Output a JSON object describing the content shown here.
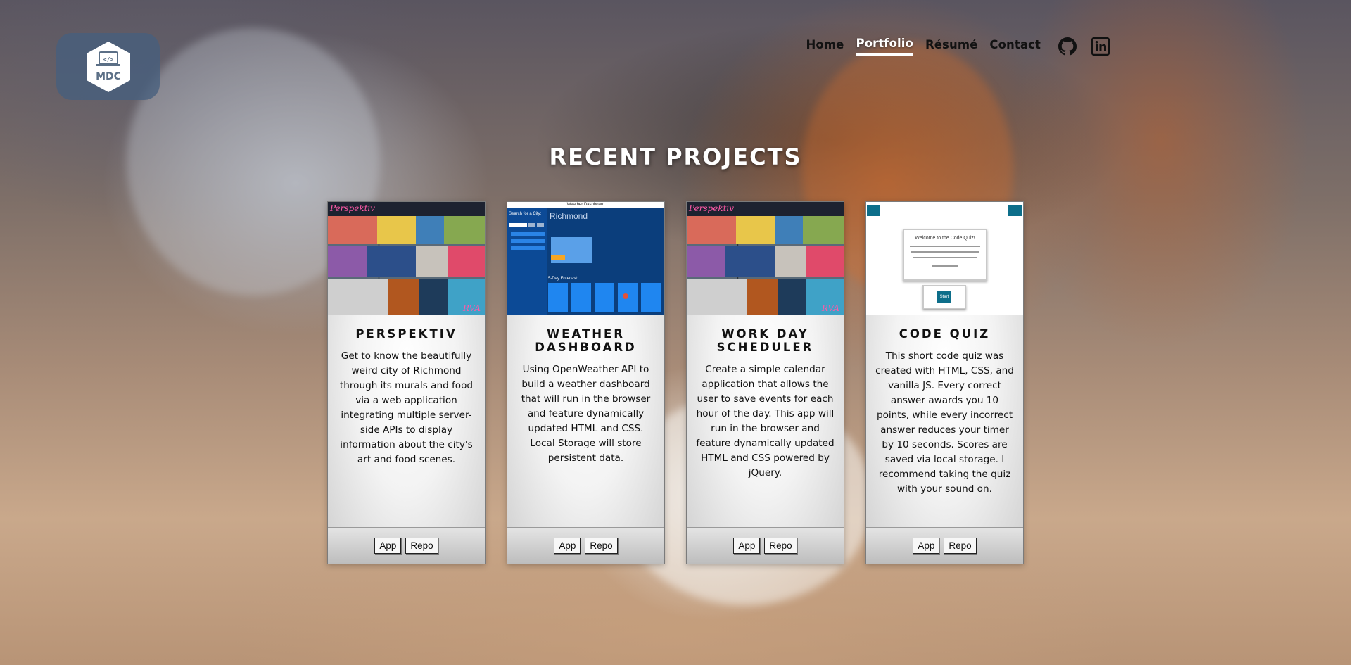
{
  "logo": {
    "text": "MDC",
    "code_glyph": "</>"
  },
  "nav": {
    "items": [
      {
        "label": "Home",
        "active": false
      },
      {
        "label": "Portfolio",
        "active": true
      },
      {
        "label": "Résumé",
        "active": false
      },
      {
        "label": "Contact",
        "active": false
      }
    ],
    "social": [
      "github-icon",
      "linkedin-icon"
    ]
  },
  "section": {
    "title": "RECENT PROJECTS"
  },
  "projects": [
    {
      "title": "PERSPEKTIV",
      "description": "Get to know the beautifully weird city of Richmond through its murals and food via a web application integrating multiple server-side APIs to display information about the city's art and food scenes.",
      "app_label": "App",
      "repo_label": "Repo",
      "thumb": {
        "brand": "Perspektiv",
        "corner": "RVA"
      }
    },
    {
      "title": "WEATHER DASHBOARD",
      "description": "Using OpenWeather API to build a weather dashboard that will run in the browser and feature dynamically updated HTML and CSS. Local Storage will store persistent data.",
      "app_label": "App",
      "repo_label": "Repo",
      "thumb": {
        "header": "Weather Dashboard",
        "search": "Search for a City:",
        "city": "Richmond",
        "forecast": "5-Day Forecast:"
      }
    },
    {
      "title": "WORK DAY SCHEDULER",
      "description": "Create a simple calendar application that allows the user to save events for each hour of the day. This app will run in the browser and feature dynamically updated HTML and CSS powered by jQuery.",
      "app_label": "App",
      "repo_label": "Repo",
      "thumb": {
        "brand": "Perspektiv",
        "corner": "RVA"
      }
    },
    {
      "title": "CODE QUIZ",
      "description": "This short code quiz was created with HTML, CSS, and vanilla JS. Every correct answer awards you 10 points, while every incorrect answer reduces your timer by 10 seconds. Scores are saved via local storage. I recommend taking the quiz with your sound on.",
      "app_label": "App",
      "repo_label": "Repo",
      "thumb": {
        "welcome": "Welcome to the Code Quiz!",
        "start": "Start"
      }
    }
  ],
  "colors": {
    "nav_text": "#121212",
    "active_nav": "#ffffff",
    "logo_bg": "#465f7d",
    "weather_blue": "#0b3e7c"
  }
}
